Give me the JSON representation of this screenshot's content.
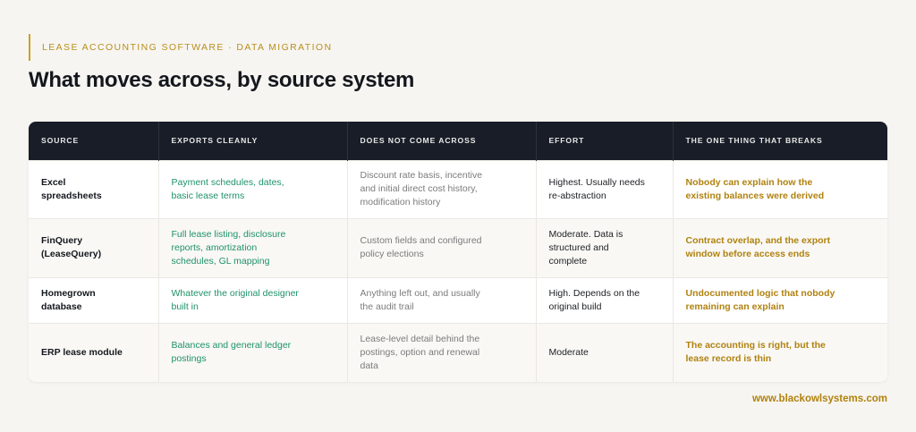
{
  "header": {
    "eyebrow": "LEASE ACCOUNTING SOFTWARE · DATA MIGRATION",
    "title": "What moves across, by source system"
  },
  "table": {
    "columns": [
      "SOURCE",
      "EXPORTS CLEANLY",
      "DOES NOT COME ACROSS",
      "EFFORT",
      "THE ONE THING THAT BREAKS"
    ],
    "rows": [
      {
        "source": "Excel spreadsheets",
        "exports": "Payment schedules, dates, basic lease terms",
        "not_across": "Discount rate basis, incentive and initial direct cost history, modification history",
        "effort": "Highest. Usually needs re-abstraction",
        "breaks": "Nobody can explain how the existing balances were derived"
      },
      {
        "source": "FinQuery (LeaseQuery)",
        "exports": "Full lease listing, disclosure reports, amortization schedules, GL mapping",
        "not_across": "Custom fields and configured policy elections",
        "effort": "Moderate. Data is structured and complete",
        "breaks": "Contract overlap, and the export window before access ends"
      },
      {
        "source": "Homegrown database",
        "exports": "Whatever the original designer built in",
        "not_across": "Anything left out, and usually the audit trail",
        "effort": "High. Depends on the original build",
        "breaks": "Undocumented logic that nobody remaining can explain"
      },
      {
        "source": "ERP lease module",
        "exports": "Balances and general ledger postings",
        "not_across": "Lease-level detail behind the postings, option and renewal data",
        "effort": "Moderate",
        "breaks": "The accounting is right, but the lease record is thin"
      }
    ]
  },
  "footer": {
    "url": "www.blackowlsystems.com"
  },
  "colors": {
    "accent_gold": "#b0820f",
    "header_dark": "#181d27",
    "positive_green": "#1e9268",
    "background": "#f7f5f1"
  }
}
